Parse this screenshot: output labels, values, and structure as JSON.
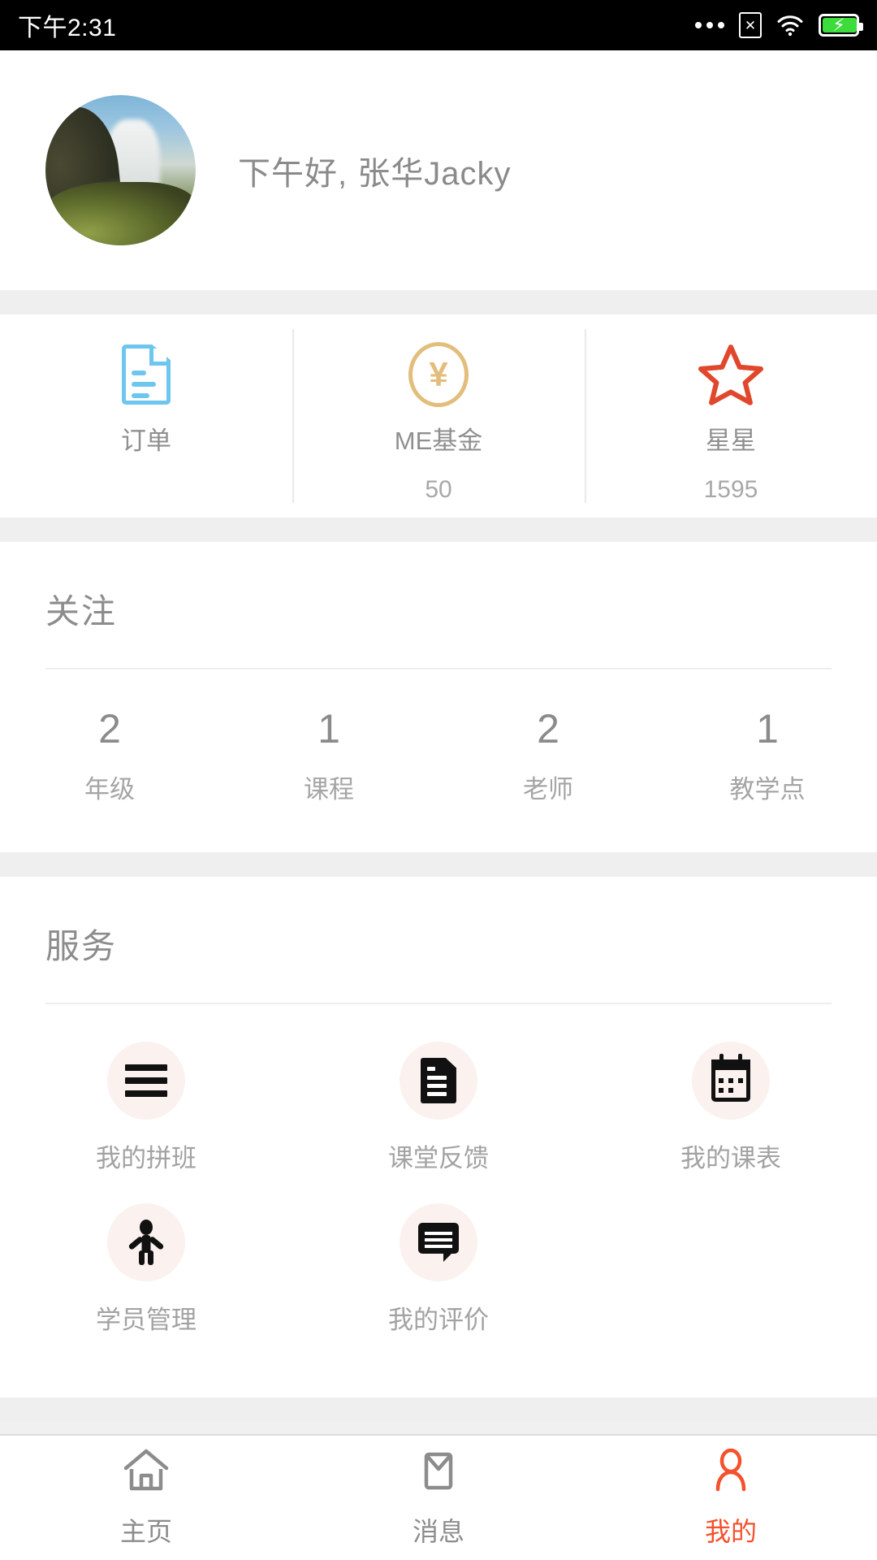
{
  "status_bar": {
    "time": "下午2:31",
    "icons": [
      "more-dots-icon",
      "sim-x-icon",
      "wifi-icon",
      "battery-charging-icon"
    ],
    "sim_glyph": "✕",
    "battery_glyph": "⚡",
    "battery_color": "#3ddc3d"
  },
  "profile": {
    "greeting": "下午好, 张华Jacky",
    "avatar_alt": "waterfall-photo"
  },
  "stats": {
    "items": [
      {
        "label": "订单",
        "value": "",
        "icon": "document-icon",
        "color": "#6ec6ef"
      },
      {
        "label": "ME基金",
        "value": "50",
        "icon": "yuan-coin-icon",
        "color": "#e3bd7c",
        "glyph": "¥"
      },
      {
        "label": "星星",
        "value": "1595",
        "icon": "star-icon",
        "color": "#e0472c"
      }
    ]
  },
  "follow": {
    "title": "关注",
    "cells": [
      {
        "num": "2",
        "cap": "年级"
      },
      {
        "num": "1",
        "cap": "课程"
      },
      {
        "num": "2",
        "cap": "老师"
      },
      {
        "num": "1",
        "cap": "教学点"
      }
    ]
  },
  "services": {
    "title": "服务",
    "items": [
      {
        "label": "我的拼班",
        "icon": "list-icon"
      },
      {
        "label": "课堂反馈",
        "icon": "document-filled-icon"
      },
      {
        "label": "我的课表",
        "icon": "calendar-icon"
      },
      {
        "label": "学员管理",
        "icon": "person-raised-arms-icon"
      },
      {
        "label": "我的评价",
        "icon": "chat-bubble-icon"
      }
    ],
    "bubble_color": "#fbf2ef"
  },
  "tabbar": {
    "active_color": "#f4512c",
    "inactive_color": "#8c8c8c",
    "tabs": [
      {
        "label": "主页",
        "icon": "home-icon",
        "active": false
      },
      {
        "label": "消息",
        "icon": "mail-icon",
        "active": false
      },
      {
        "label": "我的",
        "icon": "person-icon",
        "active": true
      }
    ]
  }
}
